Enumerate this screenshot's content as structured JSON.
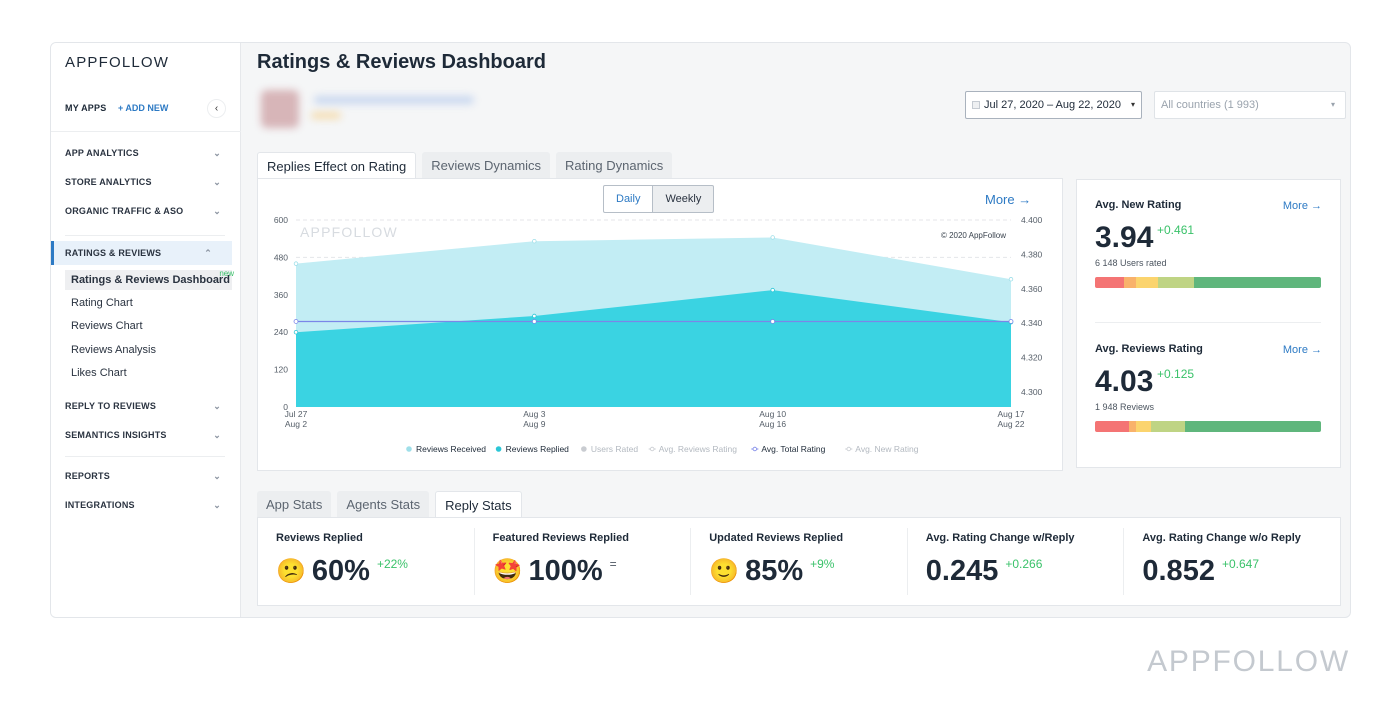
{
  "sidebar": {
    "logo": "APPFOLLOW",
    "my_apps": "MY APPS",
    "add_new": "+ ADD NEW",
    "collapse_icon": "‹",
    "sections": [
      {
        "label": "APP ANALYTICS",
        "chevron": "⌄"
      },
      {
        "label": "STORE ANALYTICS",
        "chevron": "⌄"
      },
      {
        "label": "ORGANIC TRAFFIC & ASO",
        "chevron": "⌄"
      },
      {
        "label": "RATINGS & REVIEWS",
        "chevron": "⌃"
      },
      {
        "label": "REPLY TO REVIEWS",
        "chevron": "⌄"
      },
      {
        "label": "SEMANTICS INSIGHTS",
        "chevron": "⌄"
      },
      {
        "label": "REPORTS",
        "chevron": "⌄"
      },
      {
        "label": "INTEGRATIONS",
        "chevron": "⌄"
      }
    ],
    "sub_items": [
      {
        "label": "Ratings & Reviews Dashboard",
        "badge": "new"
      },
      {
        "label": "Rating Chart"
      },
      {
        "label": "Reviews Chart"
      },
      {
        "label": "Reviews Analysis"
      },
      {
        "label": "Likes Chart"
      }
    ]
  },
  "header": {
    "title": "Ratings & Reviews Dashboard",
    "date_range": "Jul 27, 2020 – Aug 22, 2020",
    "date_caret": "▾",
    "country": "All countries (1 993)",
    "country_caret": "▾"
  },
  "chart_tabs": [
    "Replies Effect on Rating",
    "Reviews Dynamics",
    "Rating Dynamics"
  ],
  "chart_controls": {
    "daily": "Daily",
    "weekly": "Weekly",
    "more": "More →"
  },
  "chart_data": {
    "type": "area",
    "title": "",
    "watermark": "APPFOLLOW",
    "copyright": "© 2020 AppFollow",
    "x": [
      [
        "Jul 27",
        "Aug 2"
      ],
      [
        "Aug 3",
        "Aug 9"
      ],
      [
        "Aug 10",
        "Aug 16"
      ],
      [
        "Aug 17",
        "Aug 22"
      ]
    ],
    "y_left": {
      "ticks": [
        "0",
        "120",
        "240",
        "360",
        "480",
        "600"
      ],
      "range": [
        0,
        600
      ]
    },
    "y_right": {
      "ticks": [
        "4.300",
        "4.320",
        "4.340",
        "4.360",
        "4.380",
        "4.400"
      ],
      "range": [
        4.3,
        4.4
      ]
    },
    "grid": true,
    "legend_placement": "bottom",
    "series": [
      {
        "name": "Reviews Received",
        "axis": "left",
        "kind": "area",
        "color": "#c2edf4",
        "active": true,
        "values": [
          460,
          532,
          544,
          410
        ]
      },
      {
        "name": "Reviews Replied",
        "axis": "left",
        "kind": "area",
        "color": "#3ad3e2",
        "active": true,
        "values": [
          240,
          292,
          375,
          272
        ]
      },
      {
        "name": "Users Rated",
        "axis": "left",
        "kind": "area",
        "color": "#c9ccd1",
        "active": false,
        "values": []
      },
      {
        "name": "Avg. Reviews Rating",
        "axis": "right",
        "kind": "line",
        "color": "#c9ccd1",
        "active": false,
        "values": []
      },
      {
        "name": "Avg. Total Rating",
        "axis": "right",
        "kind": "line",
        "color": "#7b86e8",
        "active": true,
        "values": [
          4.341,
          4.341,
          4.341,
          4.341
        ]
      },
      {
        "name": "Avg. New Rating",
        "axis": "right",
        "kind": "line",
        "color": "#c9ccd1",
        "active": false,
        "values": []
      }
    ]
  },
  "rating_cards": [
    {
      "title": "Avg. New Rating",
      "more": "More →",
      "value": "3.94",
      "delta": "+0.461",
      "sub": "6 148 Users rated",
      "distribution": [
        0.13,
        0.05,
        0.1,
        0.16,
        0.56
      ]
    },
    {
      "title": "Avg. Reviews Rating",
      "more": "More →",
      "value": "4.03",
      "delta": "+0.125",
      "sub": "1 948 Reviews",
      "distribution": [
        0.15,
        0.03,
        0.07,
        0.15,
        0.6
      ]
    }
  ],
  "rating_colors": [
    "#f47474",
    "#f9b26b",
    "#fbd46e",
    "#bfd484",
    "#5fb67c"
  ],
  "stats_tabs": [
    "App Stats",
    "Agents Stats",
    "Reply Stats"
  ],
  "stats": [
    {
      "title": "Reviews Replied",
      "emoji": "😕",
      "value": "60%",
      "delta": "+22%"
    },
    {
      "title": "Featured Reviews Replied",
      "emoji": "🤩",
      "value": "100%",
      "delta": "="
    },
    {
      "title": "Updated Reviews Replied",
      "emoji": "🙂",
      "value": "85%",
      "delta": "+9%"
    },
    {
      "title": "Avg. Rating Change w/Reply",
      "emoji": "",
      "value": "0.245",
      "delta": "+0.266"
    },
    {
      "title": "Avg. Rating Change w/o Reply",
      "emoji": "",
      "value": "0.852",
      "delta": "+0.647"
    }
  ],
  "footer_watermark": "APPFOLLOW"
}
